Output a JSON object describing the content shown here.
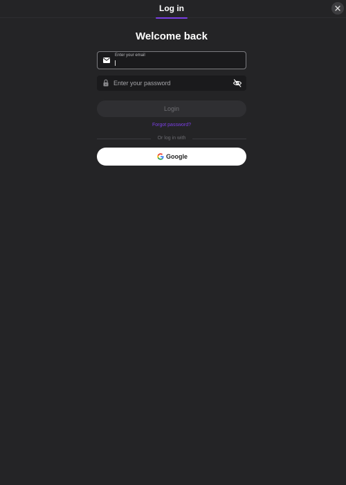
{
  "header": {
    "tab_label": "Log in"
  },
  "main": {
    "title": "Welcome back",
    "email": {
      "label": "Enter your email",
      "value": ""
    },
    "password": {
      "placeholder": "Enter your password",
      "value": ""
    },
    "login_label": "Login",
    "forgot_label": "Forgot password?",
    "divider_label": "Or log in with",
    "google_label": "Google"
  },
  "colors": {
    "background": "#242426",
    "accent": "#7b3fe4",
    "field_bg": "#1a1a1c",
    "login_disabled_bg": "#2f2f32"
  },
  "icons": [
    "close-icon",
    "mail-icon",
    "lock-icon",
    "eye-off-icon",
    "google-icon"
  ]
}
